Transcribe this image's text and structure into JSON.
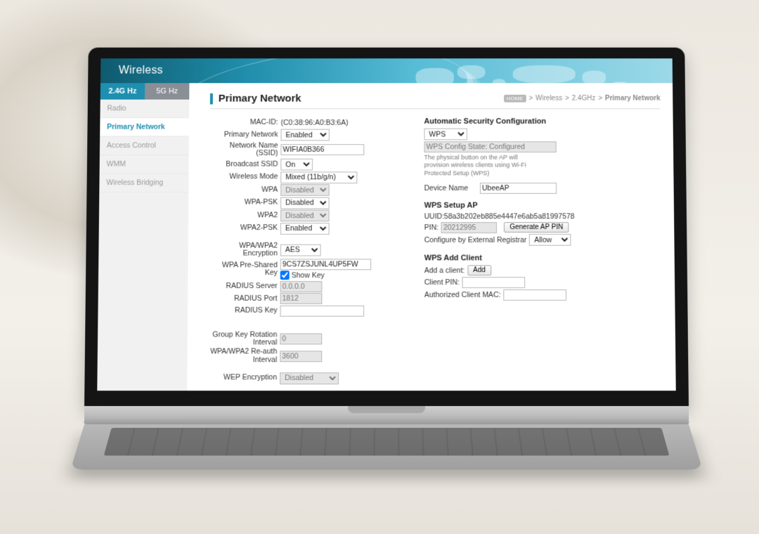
{
  "header": {
    "title": "Wireless"
  },
  "tabs": {
    "g24": "2.4G Hz",
    "g5": "5G Hz"
  },
  "nav": {
    "radio": "Radio",
    "primary": "Primary Network",
    "acl": "Access Control",
    "wmm": "WMM",
    "bridging": "Wireless Bridging"
  },
  "page": {
    "title": "Primary Network"
  },
  "crumb": {
    "badge": "HOME",
    "a": "Wireless",
    "b": "2.4GHz",
    "c": "Primary Network",
    "sep": ">"
  },
  "left": {
    "mac_lbl": "MAC-ID:",
    "mac_val": "(C0:38:96:A0:B3:6A)",
    "pnet_lbl": "Primary Network",
    "pnet_val": "Enabled",
    "ssid_lbl": "Network Name (SSID)",
    "ssid_val": "WIFIA0B366",
    "bcast_lbl": "Broadcast SSID",
    "bcast_val": "On",
    "wmode_lbl": "Wireless Mode",
    "wmode_val": "Mixed (11b/g/n)",
    "wpa_lbl": "WPA",
    "wpa_val": "Disabled",
    "wpapsk_lbl": "WPA-PSK",
    "wpapsk_val": "Disabled",
    "wpa2_lbl": "WPA2",
    "wpa2_val": "Disabled",
    "wpa2psk_lbl": "WPA2-PSK",
    "wpa2psk_val": "Enabled",
    "enc_lbl": "WPA/WPA2 Encryption",
    "enc_val": "AES",
    "psk_lbl": "WPA Pre-Shared Key",
    "psk_val": "9CS7ZSJUNL4UP5FW",
    "showkey": "Show Key",
    "rserver_lbl": "RADIUS Server",
    "rserver_val": "0.0.0.0",
    "rport_lbl": "RADIUS Port",
    "rport_val": "1812",
    "rkey_lbl": "RADIUS Key",
    "rkey_val": "",
    "grot_lbl": "Group Key Rotation Interval",
    "grot_val": "0",
    "reauth_lbl": "WPA/WPA2 Re-auth Interval",
    "reauth_val": "3600",
    "wep_lbl": "WEP Encryption",
    "wep_val": "Disabled"
  },
  "right": {
    "asc_title": "Automatic Security Configuration",
    "asc_mode": "WPS",
    "asc_state": "WPS Config State: Configured",
    "asc_note": "The physical button on the AP will provision wireless clients using Wi-Fi Protected Setup (WPS)",
    "devname_lbl": "Device Name",
    "devname_val": "UbeeAP",
    "wpssetup_title": "WPS Setup AP",
    "uuid_lbl": "UUID:",
    "uuid_val": "58a3b202eb885e4447e6ab5a81997578",
    "pin_lbl": "PIN:",
    "pin_val": "20212995",
    "gen_pin": "Generate AP PIN",
    "cer_lbl": "Configure by External Registrar",
    "cer_val": "Allow",
    "addcli_title": "WPS Add Client",
    "addcli_lbl": "Add a client:",
    "add_btn": "Add",
    "cpin_lbl": "Client PIN:",
    "cpin_val": "",
    "amac_lbl": "Authorized Client MAC:",
    "amac_val": ""
  }
}
